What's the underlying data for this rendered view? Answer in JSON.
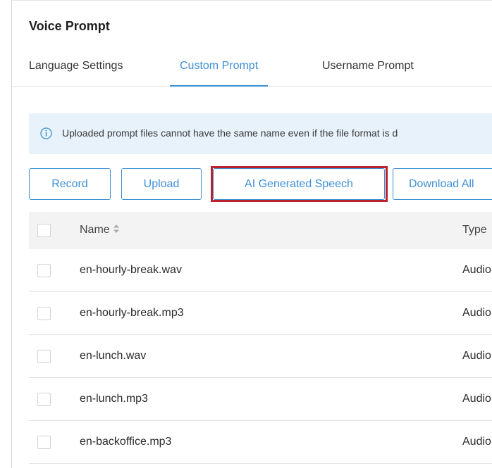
{
  "header": {
    "title": "Voice Prompt"
  },
  "tabs": [
    {
      "label": "Language Settings",
      "active": false
    },
    {
      "label": "Custom Prompt",
      "active": true
    },
    {
      "label": "Username Prompt",
      "active": false
    }
  ],
  "notice": {
    "icon": "info-icon",
    "text": "Uploaded prompt files cannot have the same name even if the file format is d"
  },
  "toolbar": {
    "record_label": "Record",
    "upload_label": "Upload",
    "ai_label": "AI Generated Speech",
    "download_label": "Download All"
  },
  "table": {
    "columns": {
      "name": "Name",
      "type": "Type"
    },
    "rows": [
      {
        "name": "en-hourly-break.wav",
        "type": "Audio"
      },
      {
        "name": "en-hourly-break.mp3",
        "type": "Audio"
      },
      {
        "name": "en-lunch.wav",
        "type": "Audio"
      },
      {
        "name": "en-lunch.mp3",
        "type": "Audio"
      },
      {
        "name": "en-backoffice.mp3",
        "type": "Audio"
      }
    ]
  },
  "colors": {
    "accent": "#3d8fd6",
    "highlight": "#b8232e",
    "notice_bg": "#e7f2fb",
    "header_bg": "#f3f3f3"
  }
}
